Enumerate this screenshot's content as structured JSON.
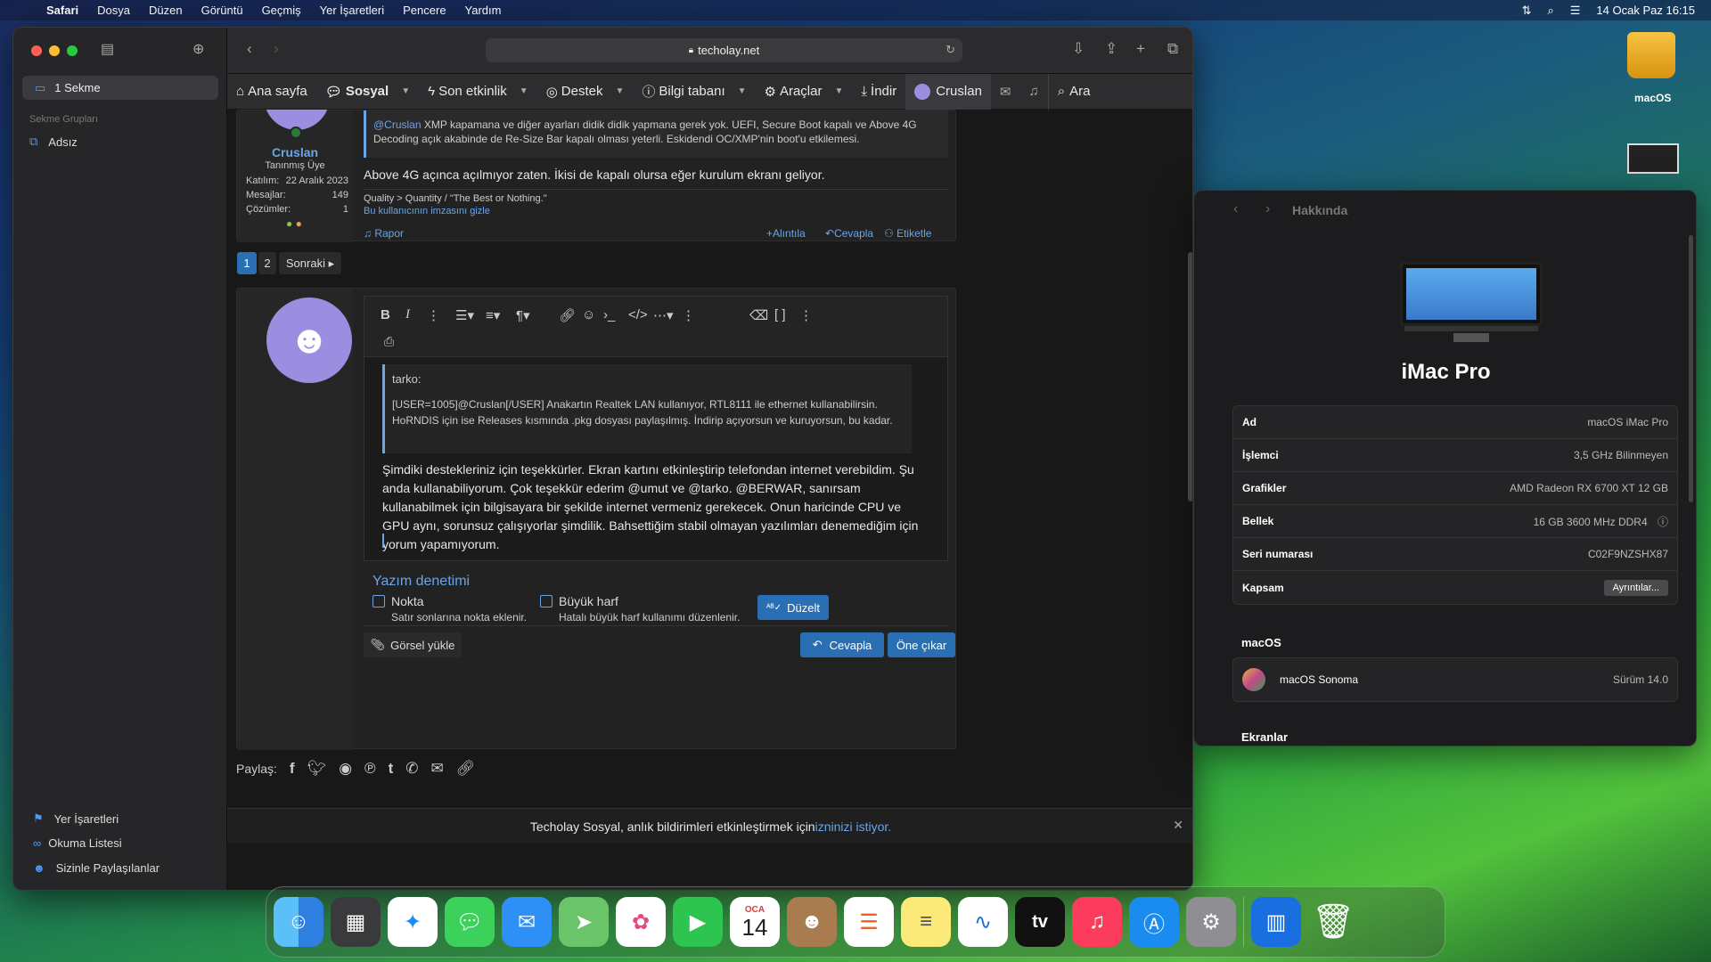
{
  "menubar": {
    "app": "Safari",
    "items": [
      "Dosya",
      "Düzen",
      "Görüntü",
      "Geçmiş",
      "Yer İşaretleri",
      "Pencere",
      "Yardım"
    ],
    "datetime": "14 Ocak Paz  16:15"
  },
  "desktop": {
    "drive_label": "macOS"
  },
  "safari": {
    "sidebar": {
      "tab_count": "1 Sekme",
      "groups_title": "Sekme Grupları",
      "group_item": "Adsız",
      "bookmarks": "Yer İşaretleri",
      "reading_list": "Okuma Listesi",
      "shared": "Sizinle Paylaşılanlar"
    },
    "url": "techolay.net",
    "nav": {
      "home": "Ana sayfa",
      "social": "Sosyal",
      "recent": "Son etkinlik",
      "support": "Destek",
      "kb": "Bilgi tabanı",
      "tools": "Araçlar",
      "download": "İndir",
      "user": "Cruslan",
      "search": "Ara"
    },
    "post": {
      "username": "Cruslan",
      "role": "Tanınmış Üye",
      "joined_k": "Katılım:",
      "joined_v": "22 Aralık 2023",
      "msgs_k": "Mesajlar:",
      "msgs_v": "149",
      "sol_k": "Çözümler:",
      "sol_v": "1",
      "quote_mention": "@Cruslan",
      "quote_rest": " XMP kapamana ve diğer ayarları didik didik yapmana gerek yok. UEFI, Secure Boot kapalı ve Above 4G Decoding açık akabinde de Re-Size Bar kapalı olması yeterli. Eskidendi OC/XMP'nin boot'u etkilemesi.",
      "body": "Above 4G açınca açılmıyor zaten. İkisi de kapalı olursa eğer kurulum ekranı geliyor.",
      "signature": "Quality > Quantity / \"The Best or Nothing.\"",
      "hide_sig": "Bu kullanıcının imzasını gizle",
      "report": "Rapor",
      "quote_btn": "Alıntıla",
      "reply_btn": "Cevapla",
      "tag_btn": "Etiketle"
    },
    "pagination": {
      "p1": "1",
      "p2": "2",
      "next": "Sonraki"
    },
    "editor": {
      "quote_author": "tarko:",
      "quote_text": "[USER=1005]@Cruslan[/USER] Anakartın Realtek LAN kullanıyor, RTL8111 ile ethernet kullanabilirsin. HoRNDIS için ise Releases kısmında .pkg dosyası paylaşılmış. İndirip açıyorsun ve kuruyorsun, bu kadar.",
      "text": "Şimdiki destekleriniz için teşekkürler. Ekran kartını etkinleştirip telefondan internet verebildim. Şu anda kullanabiliyorum. Çok teşekkür ederim @umut ve @tarko. @BERWAR, sanırsam kullanabilmek için bilgisayara bir şekilde internet vermeniz gerekecek. Onun haricinde CPU ve GPU aynı, sorunsuz çalışıyorlar şimdilik. Bahsettiğim stabil olmayan yazılımları denemediğim için yorum yapamıyorum.",
      "spell_title": "Yazım denetimi",
      "opt1": "Nokta",
      "opt1_desc": "Satır sonlarına nokta eklenir.",
      "opt2": "Büyük harf",
      "opt2_desc": "Hatalı büyük harf kullanımı düzenlenir.",
      "fix_btn": "Düzelt",
      "upload": "Görsel yükle",
      "submit": "Cevapla",
      "preview": "Öne çıkar"
    },
    "share_label": "Paylaş:",
    "notice_text": "Techolay Sosyal, anlık bildirimleri etkinleştirmek için ",
    "notice_link": "izninizi istiyor."
  },
  "about": {
    "title": "Hakkında",
    "model": "iMac Pro",
    "specs": [
      {
        "k": "Ad",
        "v": "macOS iMac Pro"
      },
      {
        "k": "İşlemci",
        "v": "3,5 GHz Bilinmeyen"
      },
      {
        "k": "Grafikler",
        "v": "AMD Radeon RX 6700 XT 12 GB"
      },
      {
        "k": "Bellek",
        "v": "16 GB 3600 MHz DDR4"
      },
      {
        "k": "Seri numarası",
        "v": "C02F9NZSHX87"
      },
      {
        "k": "Kapsam",
        "v": "Ayrıntılar..."
      }
    ],
    "macos_section": "macOS",
    "macos_name": "macOS Sonoma",
    "macos_version": "Sürüm 14.0",
    "displays_section": "Ekranlar"
  },
  "dock": {
    "calendar_month": "OCA",
    "calendar_day": "14",
    "tv_label": "tv"
  }
}
